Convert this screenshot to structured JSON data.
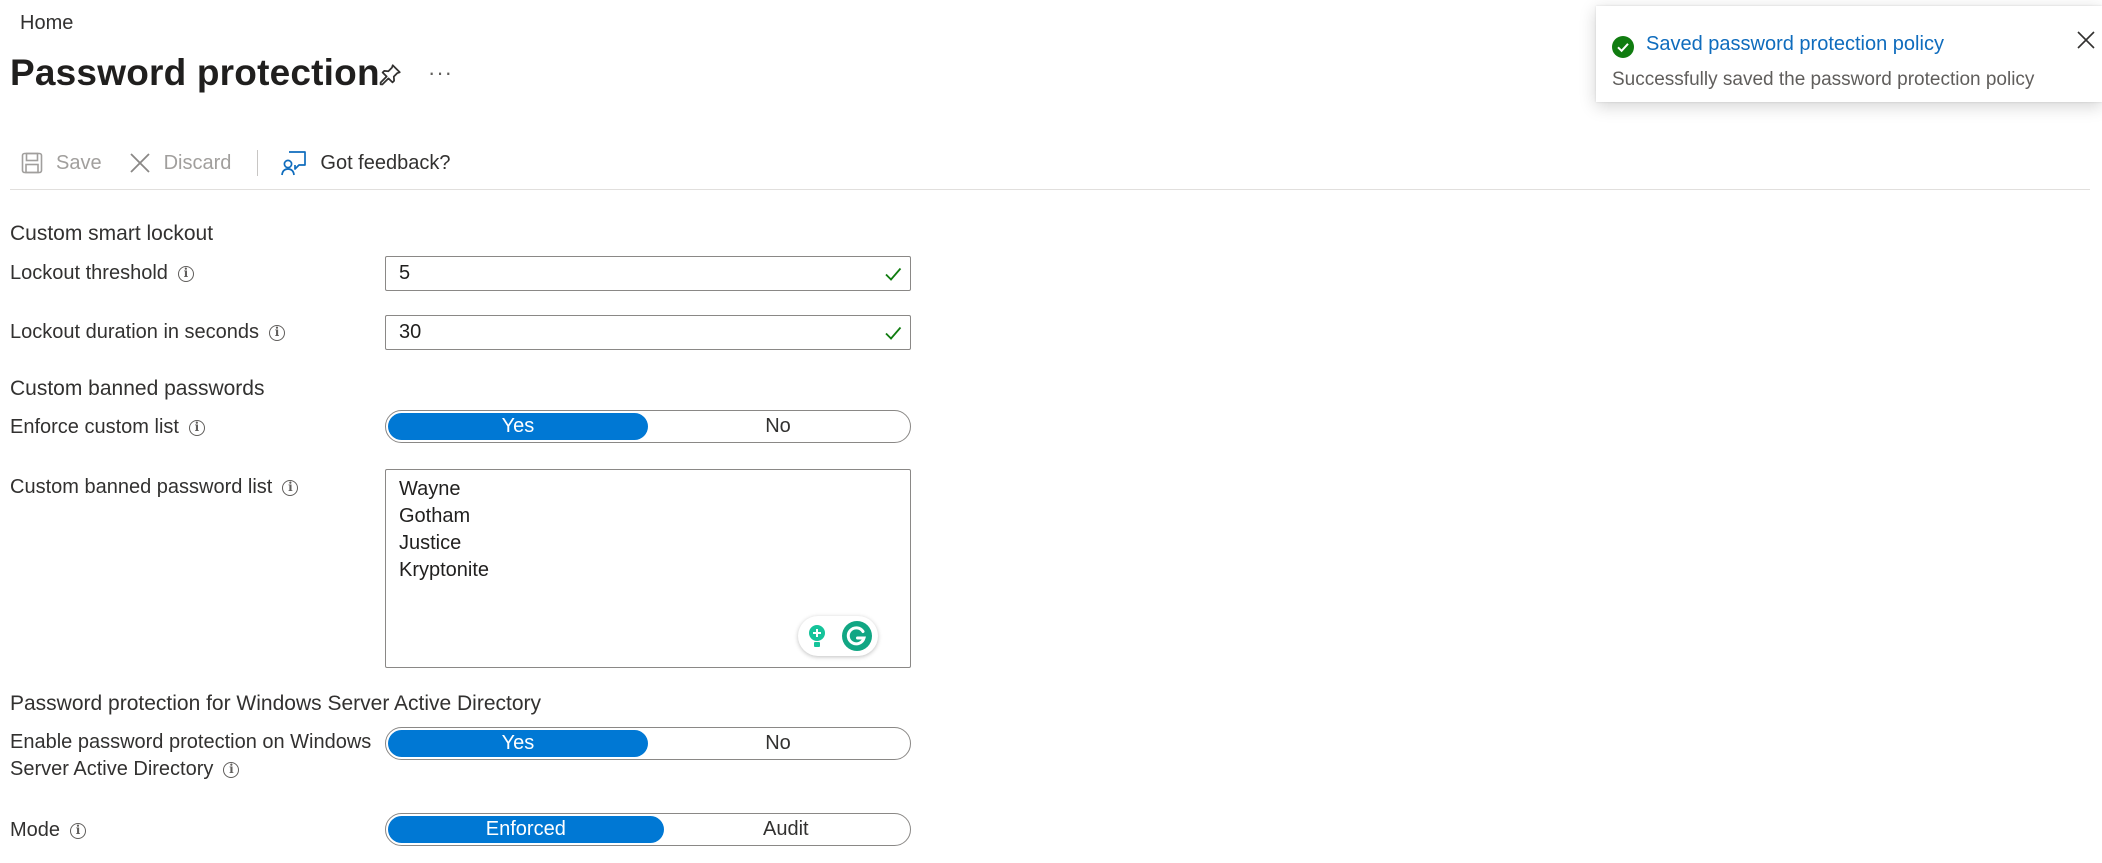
{
  "breadcrumb": {
    "home": "Home"
  },
  "page": {
    "title": "Password protection",
    "more": "···"
  },
  "toolbar": {
    "save": "Save",
    "discard": "Discard",
    "feedback": "Got feedback?"
  },
  "smart_lockout": {
    "section": "Custom smart lockout",
    "threshold_label": "Lockout threshold",
    "threshold_value": "5",
    "duration_label": "Lockout duration in seconds",
    "duration_value": "30"
  },
  "banned": {
    "section": "Custom banned passwords",
    "enforce_label": "Enforce custom list",
    "enforce_yes": "Yes",
    "enforce_no": "No",
    "enforce_selected": "Yes",
    "list_label": "Custom banned password list",
    "list": [
      "Wayne",
      "Gotham",
      "Justice",
      "Kryptonite"
    ]
  },
  "ad": {
    "section": "Password protection for Windows Server Active Directory",
    "enable_label_line1": "Enable password protection on Windows",
    "enable_label_line2": "Server Active Directory",
    "enable_yes": "Yes",
    "enable_no": "No",
    "enable_selected": "Yes",
    "mode_label": "Mode",
    "mode_enforced": "Enforced",
    "mode_audit": "Audit",
    "mode_selected": "Enforced"
  },
  "toast": {
    "title": "Saved password protection policy",
    "message": "Successfully saved the password protection policy"
  },
  "colors": {
    "accent": "#0078d4",
    "success": "#107c10",
    "link": "#0f6cbd"
  },
  "icons": [
    "pin-icon",
    "save-icon",
    "close-icon",
    "feedback-icon",
    "info-icon",
    "checkmark-icon",
    "success-icon",
    "grammarly-icon"
  ]
}
